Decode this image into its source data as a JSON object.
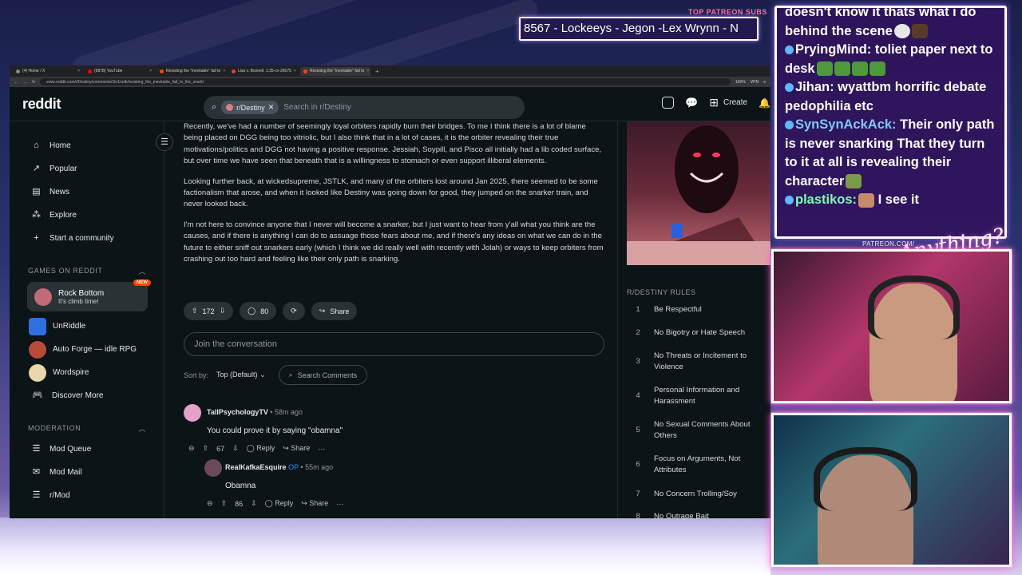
{
  "stream": {
    "patreon_title": "TOP PATREON SUBS",
    "ticker_text": "8567 - Lockeeys - Jegon -Lex Wrynn - N",
    "patreon_url": "PATREON.COM/",
    "signature": "Anything?"
  },
  "browser": {
    "tabs": [
      {
        "label": "(4) Home / X"
      },
      {
        "label": "(9878) YouTube"
      },
      {
        "label": "Resisting the \"inevitable\" fall to"
      },
      {
        "label": "Lisa v. Bonnell, 1:25-cv-26075"
      },
      {
        "label": "Resisting the \"inevitable\" fall to"
      }
    ],
    "url": "www.reddit.com/r/Destiny/comments/1kr1nelk/resisting_the_inevitable_fall_to_the_snark/",
    "zoom": "160%",
    "vpn_label": "VPN"
  },
  "reddit": {
    "logo": "reddit",
    "search": {
      "chip": "r/Destiny",
      "placeholder": "Search in r/Destiny"
    },
    "create_label": "Create"
  },
  "nav": {
    "items": [
      {
        "label": "Home",
        "icon": "home-icon"
      },
      {
        "label": "Popular",
        "icon": "popular-icon"
      },
      {
        "label": "News",
        "icon": "news-icon"
      },
      {
        "label": "Explore",
        "icon": "explore-icon"
      },
      {
        "label": "Start a community",
        "icon": "plus-icon"
      }
    ],
    "games_header": "GAMES ON REDDIT",
    "featured_game": {
      "title": "Rock Bottom",
      "subtitle": "It's climb time!",
      "badge": "NEW"
    },
    "games": [
      {
        "label": "UnRiddle"
      },
      {
        "label": "Auto Forge — idle RPG"
      },
      {
        "label": "Wordspire"
      },
      {
        "label": "Discover More"
      }
    ],
    "moderation_header": "MODERATION",
    "moderation": [
      {
        "label": "Mod Queue"
      },
      {
        "label": "Mod Mail"
      },
      {
        "label": "r/Mod"
      }
    ]
  },
  "post": {
    "paragraphs": [
      "Recently, we've had a number of seemingly loyal orbiters rapidly burn their bridges. To me I think there is a lot of blame being placed on DGG being too vitriolic, but I also think that in a lot of cases, it is the orbiter revealing their true motivations/politics and DGG not having a positive response. Jessiah, Soypill, and Pisco all initially had a lib coded surface, but over time we have seen that beneath that is a willingness to stomach or even support illiberal elements.",
      "Looking further back, at wickedsupreme, JSTLK, and many of the orbiters lost around Jan 2025, there seemed to be some factionalism that arose, and when it looked like Destiny was going down for good, they jumped on the snarker train, and never looked back.",
      "I'm not here to convince anyone that I never will become a snarker, but I just want to hear from y'all what you think are the causes, and if there is anything I can do to assuage those fears about me, and if there's any ideas on what we can do in the future to either sniff out snarkers early (which I think we did really well with recently with Jolah) or ways to keep orbiters from crashing out too hard and feeling like their only path is snarking."
    ],
    "votes": "172",
    "comments": "80",
    "share_label": "Share",
    "join_placeholder": "Join the conversation",
    "sort_label": "Sort by:",
    "sort_value": "Top (Default)",
    "search_comments": "Search Comments"
  },
  "comments": [
    {
      "author": "TallPsychologyTV",
      "op": "",
      "time": "58m ago",
      "body": "You could prove it by saying \"obamna\"",
      "votes": "67",
      "reply": "Reply",
      "share": "Share"
    },
    {
      "author": "RealKafkaEsquire",
      "op": "OP",
      "time": "55m ago",
      "body": "Obamna",
      "votes": "86",
      "reply": "Reply",
      "share": "Share"
    }
  ],
  "rules": {
    "title": "R/DESTINY RULES",
    "items": [
      {
        "n": "1",
        "text": "Be Respectful"
      },
      {
        "n": "2",
        "text": "No Bigotry or Hate Speech"
      },
      {
        "n": "3",
        "text": "No Threats or Incitement to Violence"
      },
      {
        "n": "4",
        "text": "Personal Information and Harassment"
      },
      {
        "n": "5",
        "text": "No Sexual Comments About Others"
      },
      {
        "n": "6",
        "text": "Focus on Arguments, Not Attributes"
      },
      {
        "n": "7",
        "text": "No Concern Trolling/Soy"
      },
      {
        "n": "8",
        "text": "No Outrage Bait"
      }
    ]
  },
  "chat": [
    {
      "name": "",
      "text": "doesn't know it thats what i do behind the scene",
      "name_color": "#ffffff"
    },
    {
      "name": "PryingMind:",
      "text": " toliet paper next to desk",
      "name_color": "#ffffff"
    },
    {
      "name": "Jihan:",
      "text": " wyattbm horrific debate pedophilia etc",
      "name_color": "#ffffff"
    },
    {
      "name": "SynSynAckAck:",
      "text": " Their only path is never snarking That they turn to it at all is revealing their character",
      "name_color": "#7ec8ff"
    },
    {
      "name": "plastikos:",
      "text": " I see it",
      "name_color": "#7dffb0"
    }
  ],
  "colors": {
    "reddit_bg": "#0b1416",
    "accent": "#ff4500",
    "chat_border": "#ffffff"
  }
}
